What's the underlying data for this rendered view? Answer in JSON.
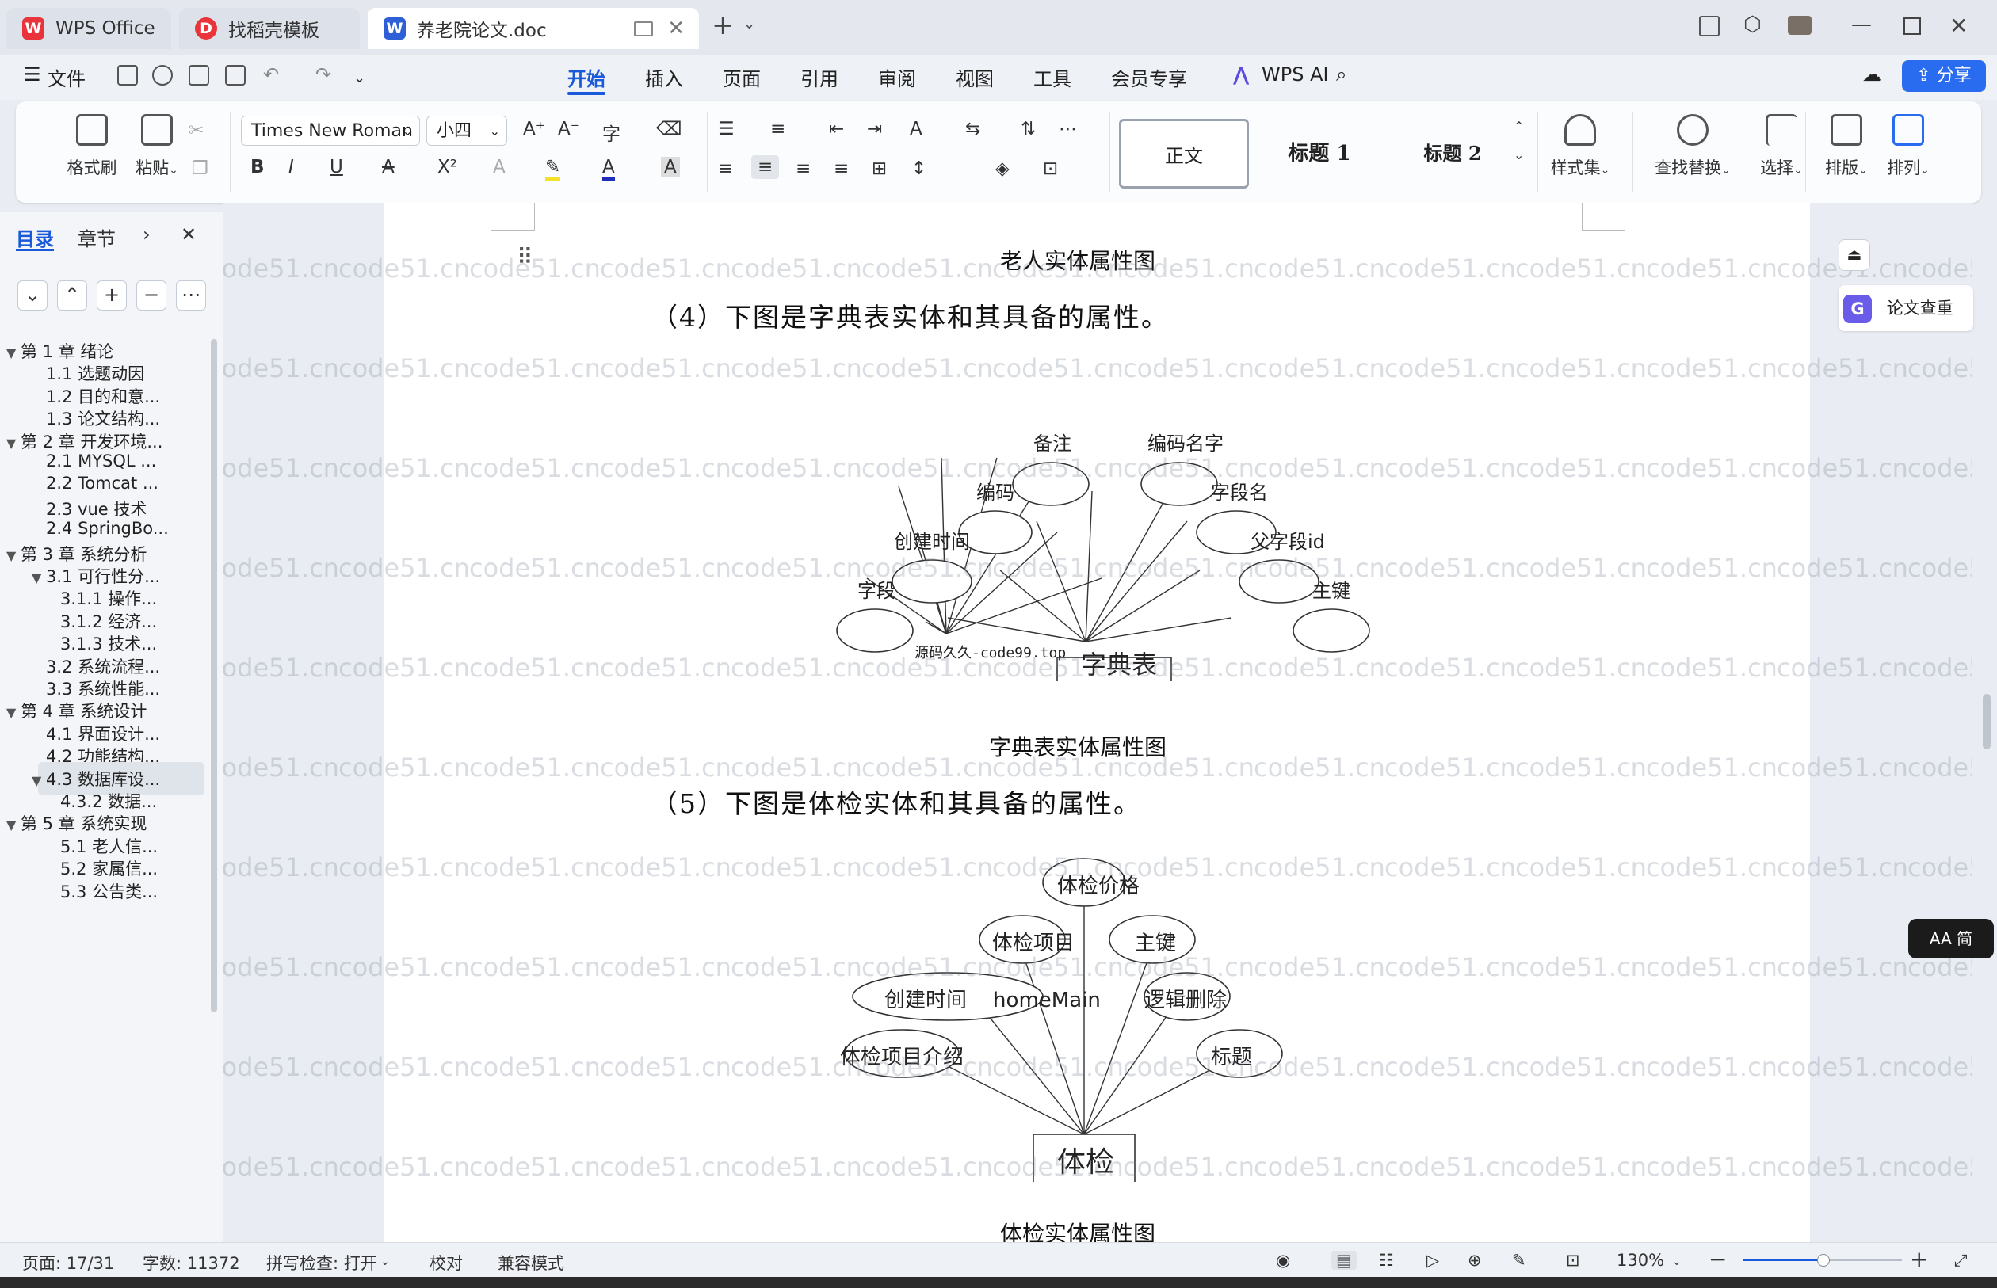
{
  "tabs": [
    {
      "label": "WPS Office",
      "logo": "W",
      "color": "#e8343a"
    },
    {
      "label": "找稻壳模板",
      "logo": "D",
      "color": "#e8343a"
    },
    {
      "label": "养老院论文.doc",
      "logo": "W",
      "color": "#2f5fd6"
    }
  ],
  "menu": {
    "file": "文件",
    "items": [
      "开始",
      "插入",
      "页面",
      "引用",
      "审阅",
      "视图",
      "工具",
      "会员专享"
    ],
    "wps_ai": "WPS AI",
    "share": "分享"
  },
  "ribbon": {
    "format_painter": "格式刷",
    "paste": "粘贴",
    "font_name": "Times New Roman",
    "font_size": "小四",
    "styles": [
      "正文",
      "标题 1",
      "标题 2"
    ],
    "style_set": "样式集",
    "find_replace": "查找替换",
    "select": "选择",
    "layout": "排版",
    "arrange": "排列"
  },
  "toc": {
    "tab_toc": "目录",
    "tab_chapter": "章节",
    "items": [
      {
        "label": "第 1 章  绪论",
        "level": 1,
        "arrow": true
      },
      {
        "label": "1.1 选题动因",
        "level": 2
      },
      {
        "label": "1.2 目的和意...",
        "level": 2
      },
      {
        "label": "1.3 论文结构...",
        "level": 2
      },
      {
        "label": "第 2 章  开发环境...",
        "level": 1,
        "arrow": true
      },
      {
        "label": "2.1 MYSQL ...",
        "level": 2
      },
      {
        "label": "2.2 Tomcat ...",
        "level": 2
      },
      {
        "label": "2.3 vue 技术",
        "level": 2
      },
      {
        "label": "2.4 SpringBo...",
        "level": 2
      },
      {
        "label": "第 3 章  系统分析",
        "level": 1,
        "arrow": true
      },
      {
        "label": "3.1 可行性分...",
        "level": 2,
        "arrow": true
      },
      {
        "label": "3.1.1 操作...",
        "level": 3
      },
      {
        "label": "3.1.2 经济...",
        "level": 3
      },
      {
        "label": "3.1.3 技术...",
        "level": 3
      },
      {
        "label": "3.2 系统流程...",
        "level": 2
      },
      {
        "label": "3.3 系统性能...",
        "level": 2
      },
      {
        "label": "第 4 章  系统设计",
        "level": 1,
        "arrow": true
      },
      {
        "label": "4.1 界面设计...",
        "level": 2
      },
      {
        "label": "4.2 功能结构...",
        "level": 2
      },
      {
        "label": "4.3 数据库设...",
        "level": 2,
        "arrow": true,
        "selected": true
      },
      {
        "label": "4.3.2  数据...",
        "level": 3
      },
      {
        "label": "第 5 章  系统实现",
        "level": 1,
        "arrow": true
      },
      {
        "label": "5.1 老人信...",
        "level": 3
      },
      {
        "label": "5.2  家属信...",
        "level": 3
      },
      {
        "label": "5.3 公告类...",
        "level": 3
      }
    ]
  },
  "doc": {
    "caption_top": "老人实体属性图",
    "para4": "（4）下图是字典表实体和其具备的属性。",
    "caption_dict": "字典表实体属性图",
    "para5": "（5）下图是体检实体和其具备的属性。",
    "caption_exam": "体检实体属性图",
    "diagram1": {
      "entity": "字典表",
      "source_note": "源码久久-code99.top",
      "attributes": [
        "备注",
        "编码名字",
        "编码",
        "字段名",
        "创建时间",
        "父字段id",
        "字段",
        "主键"
      ]
    },
    "diagram2": {
      "entity": "体检",
      "attributes": [
        "体检价格",
        "体检项目",
        "主键",
        "创建时间    homeMain",
        "逻辑删除",
        "体检项目介绍",
        "标题"
      ]
    }
  },
  "watermark": "code51.cn",
  "right_rail": {
    "paper_check": "论文查重",
    "aa_badge": "AA 简"
  },
  "status": {
    "page": "页面: 17/31",
    "words": "字数: 11372",
    "spell": "拼写检查: 打开",
    "proof": "校对",
    "compat": "兼容模式",
    "zoom": "130%",
    "zoom_level_fraction": 0.5
  }
}
